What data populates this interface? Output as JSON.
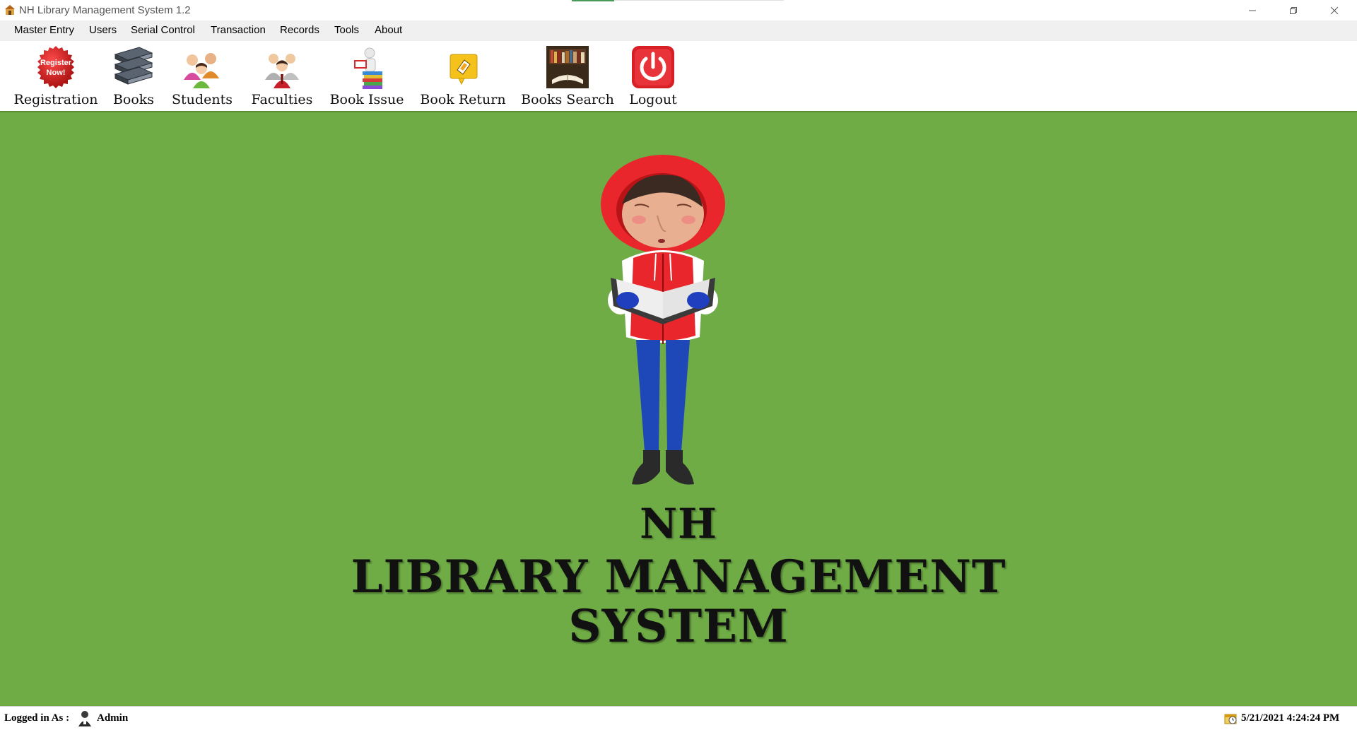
{
  "window": {
    "title": "NH Library Management System 1.2",
    "controls": [
      "minimize-icon",
      "restore-icon",
      "close-icon"
    ]
  },
  "menu": [
    {
      "label": "Master Entry"
    },
    {
      "label": "Users"
    },
    {
      "label": "Serial Control"
    },
    {
      "label": "Transaction"
    },
    {
      "label": "Records"
    },
    {
      "label": "Tools"
    },
    {
      "label": "About"
    }
  ],
  "toolbar": [
    {
      "label": "Registration",
      "icon": "register-now-icon"
    },
    {
      "label": "Books",
      "icon": "books-stack-icon"
    },
    {
      "label": "Students",
      "icon": "students-icon"
    },
    {
      "label": "Faculties",
      "icon": "faculties-icon"
    },
    {
      "label": "Book Issue",
      "icon": "book-issue-icon"
    },
    {
      "label": "Book Return",
      "icon": "book-return-icon"
    },
    {
      "label": "Books Search",
      "icon": "books-search-icon"
    },
    {
      "label": "Logout",
      "icon": "power-icon"
    }
  ],
  "register_badge": {
    "line1": "Register",
    "line2": "Now!"
  },
  "main": {
    "background": "#6fac46",
    "brand": {
      "line1": "NH",
      "line2": "LIBRARY MANAGEMENT",
      "line3": "SYSTEM"
    }
  },
  "status": {
    "logged_in_label": "Logged in As :",
    "user": "Admin",
    "datetime": "5/21/2021 4:24:24 PM"
  }
}
